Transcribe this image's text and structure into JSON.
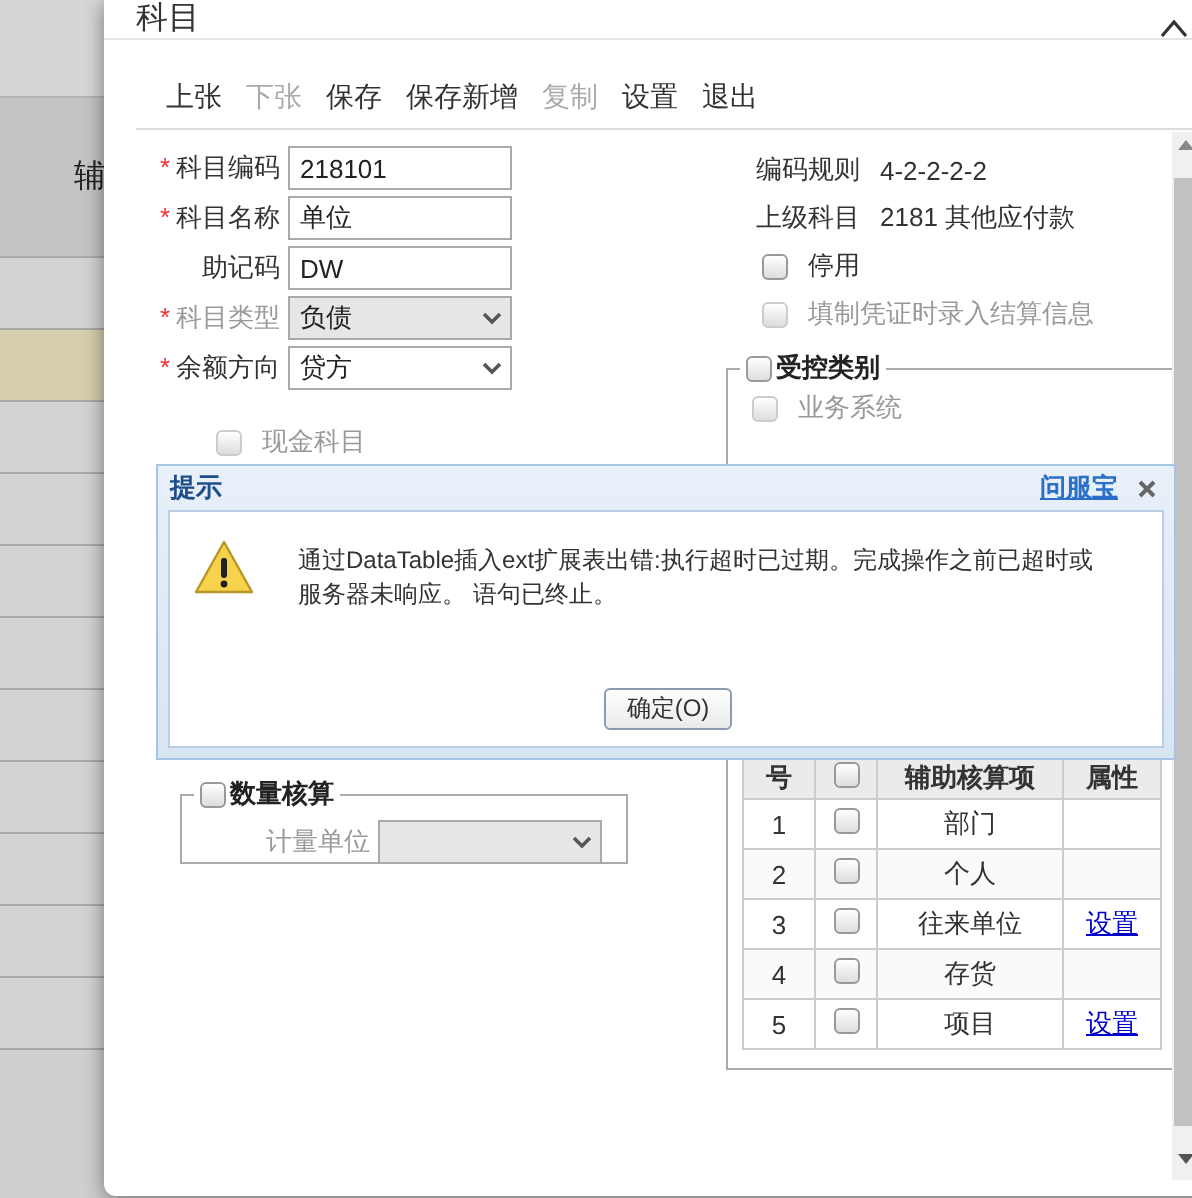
{
  "background": {
    "header": "辅",
    "rows": [
      {
        "selected": false
      },
      {
        "selected": true
      },
      {
        "selected": false
      },
      {
        "selected": false
      },
      {
        "selected": false
      },
      {
        "selected": false
      },
      {
        "selected": false
      },
      {
        "selected": false
      },
      {
        "selected": false
      },
      {
        "selected": false
      },
      {
        "selected": false
      }
    ]
  },
  "window": {
    "title": "科目"
  },
  "toolbar": [
    {
      "label": "上张",
      "disabled": false
    },
    {
      "label": "下张",
      "disabled": true
    },
    {
      "label": "保存",
      "disabled": false
    },
    {
      "label": "保存新增",
      "disabled": false
    },
    {
      "label": "复制",
      "disabled": true
    },
    {
      "label": "设置",
      "disabled": false
    },
    {
      "label": "退出",
      "disabled": false
    }
  ],
  "form": {
    "fields": [
      {
        "kind": "text",
        "marker": "*",
        "label": "科目编码",
        "value": "218101",
        "disabled": false
      },
      {
        "kind": "text",
        "marker": "*",
        "label": "科目名称",
        "value": "单位",
        "disabled": false
      },
      {
        "kind": "text",
        "label": "助记码",
        "value": "DW",
        "disabled": false
      },
      {
        "kind": "select",
        "marker": "*",
        "label": "科目类型",
        "value": "负债",
        "disabled": true
      },
      {
        "kind": "select",
        "marker": "*",
        "label": "余额方向",
        "value": "贷方",
        "disabled": false
      }
    ],
    "cash_account": {
      "label": "现金科目",
      "checked": false,
      "disabled": true
    }
  },
  "info": [
    {
      "label": "编码规则",
      "value": "4-2-2-2-2"
    },
    {
      "label": "上级科目",
      "value": "2181  其他应付款"
    }
  ],
  "options": [
    {
      "label": "停用",
      "checked": false,
      "disabled": false
    },
    {
      "label": "填制凭证时录入结算信息",
      "checked": false,
      "disabled": true
    }
  ],
  "controlled": {
    "legend": "受控类别",
    "checked": false,
    "items": [
      {
        "label": "业务系统",
        "checked": false,
        "disabled": true
      }
    ]
  },
  "quantity": {
    "legend": "数量核算",
    "checked": false,
    "unit_label": "计量单位",
    "unit_disabled": true
  },
  "aux_table": {
    "columns": [
      "号",
      "辅助核算项",
      "属性"
    ],
    "header_checked": false,
    "rows": [
      {
        "no": "1",
        "checked": false,
        "item": "部门"
      },
      {
        "no": "2",
        "checked": false,
        "item": "个人"
      },
      {
        "no": "3",
        "checked": false,
        "item": "往来单位",
        "action": "设置"
      },
      {
        "no": "4",
        "checked": false,
        "item": "存货"
      },
      {
        "no": "5",
        "checked": false,
        "item": "项目",
        "action": "设置"
      }
    ]
  },
  "alert": {
    "title": "提示",
    "link": "问服宝",
    "message": "通过DataTable插入ext扩展表出错:执行超时已过期。完成操作之前已超时或服务器未响应。 语句已终止。",
    "button": "确定(O)"
  }
}
